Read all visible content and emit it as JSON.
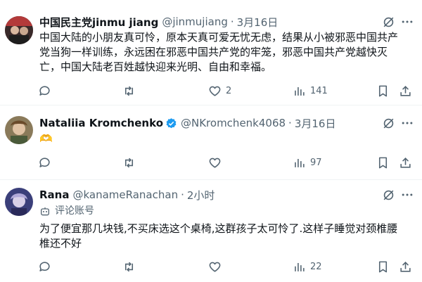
{
  "tweets": [
    {
      "name": "中国民主党jinmu jiang",
      "handle": "@jinmujiang",
      "dot": "·",
      "time": "3月16日",
      "text": "中国大陆的小朋友真可怜，原本天真可爱无忧无虑，结果从小被邪恶中国共产党当狗一样训练，永远困在邪恶中国共产党的牢笼，邪恶中国共产党越快灭亡，中国大陆老百姓越快迎来光明、自由和幸福。",
      "likes": "2",
      "views": "141"
    },
    {
      "name": "Nataliia Kromchenko",
      "handle": "@NKromchenk4068",
      "dot": "·",
      "time": "3月16日",
      "emoji": "🫶",
      "views": "97"
    },
    {
      "name": "Rana",
      "handle": "@kanameRanachan",
      "dot": "·",
      "time": "2小时",
      "label": "评论账号",
      "text": "为了便宜那几块钱,不买床选这个桌椅,这群孩子太可怜了.这样子睡觉对颈椎腰椎还不好",
      "views": "22"
    }
  ],
  "colors": {
    "muted": "#536471",
    "verified": "#1d9bf0",
    "divider": "#eff3f4"
  }
}
